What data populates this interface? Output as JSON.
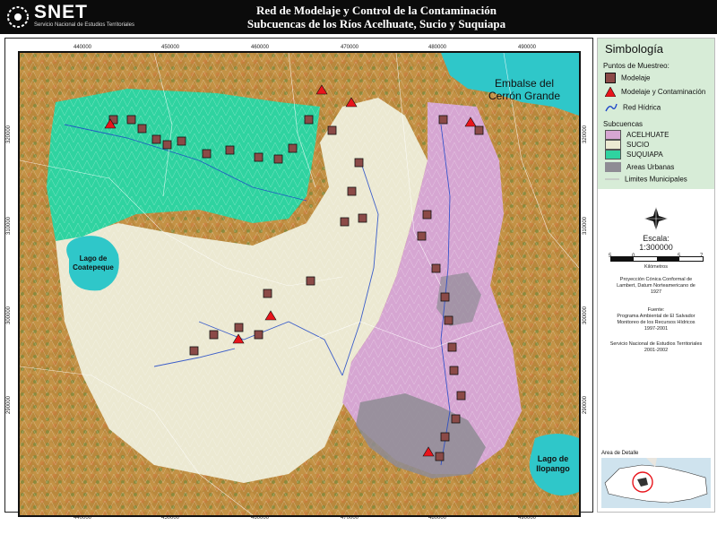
{
  "header": {
    "logo": "SNET",
    "logo_sub": "Servicio Nacional de Estudios Territoriales",
    "title_line1": "Red de Modelaje y Control de la Contaminación",
    "title_line2": "Subcuencas de los Ríos Acelhuate, Sucio y Suquiapa"
  },
  "map_labels": {
    "embalse": [
      "Embalse del",
      "Cerrón Grande"
    ],
    "coatepeque": [
      "Lago de",
      "Coatepeque"
    ],
    "ilopango": [
      "Lago de",
      "Ilopango"
    ]
  },
  "axis_ticks": {
    "top": [
      "440000",
      "450000",
      "460000",
      "470000",
      "480000",
      "490000"
    ],
    "bottom": [
      "440000",
      "450000",
      "460000",
      "470000",
      "480000",
      "490000"
    ],
    "left": [
      "320000",
      "310000",
      "300000",
      "290000"
    ],
    "right": [
      "320000",
      "310000",
      "300000",
      "290000"
    ]
  },
  "legend": {
    "title": "Simbología",
    "points_title": "Puntos de Muestreo:",
    "modelaje": "Modelaje",
    "modelaje_contaminacion": "Modelaje y Contaminación",
    "red_hidrica": "Red Hídrica",
    "subcuencas_title": "Subcuencas",
    "acelhuate": "ACELHUATE",
    "sucio": "SUCIO",
    "suquiapa": "SUQUIAPA",
    "areas_urbanas": "Areas Urbanas",
    "limites": "Limites Municipales",
    "escala_label": "Escala:",
    "escala": "1:300000",
    "scale_ticks": [
      "5",
      "0",
      "5",
      "7"
    ],
    "kilometros": "Kilómetros",
    "proyeccion": [
      "Proyección Cónica Conformal de",
      "Lambert, Datum Norteamericano de",
      "1927"
    ],
    "fuente": [
      "Fuente:",
      "Programa Ambiental de El Salvador",
      "Monitoreo de los Recursos Hídricos",
      "1997-2001"
    ],
    "servicio": [
      "Servicio Nacional de Estudios Territoriales",
      "2001-2002"
    ],
    "area_detalle": "Area de Detalle"
  },
  "colors": {
    "acelhuate": "#d6a6d2",
    "sucio": "#ece9d2",
    "suquiapa": "#2fd3a0",
    "relief": "#b88a3d",
    "urban": "#8e8c94",
    "water": "#2fc7c9",
    "marker": "#8b4a47",
    "triangle": "#e8141b"
  }
}
